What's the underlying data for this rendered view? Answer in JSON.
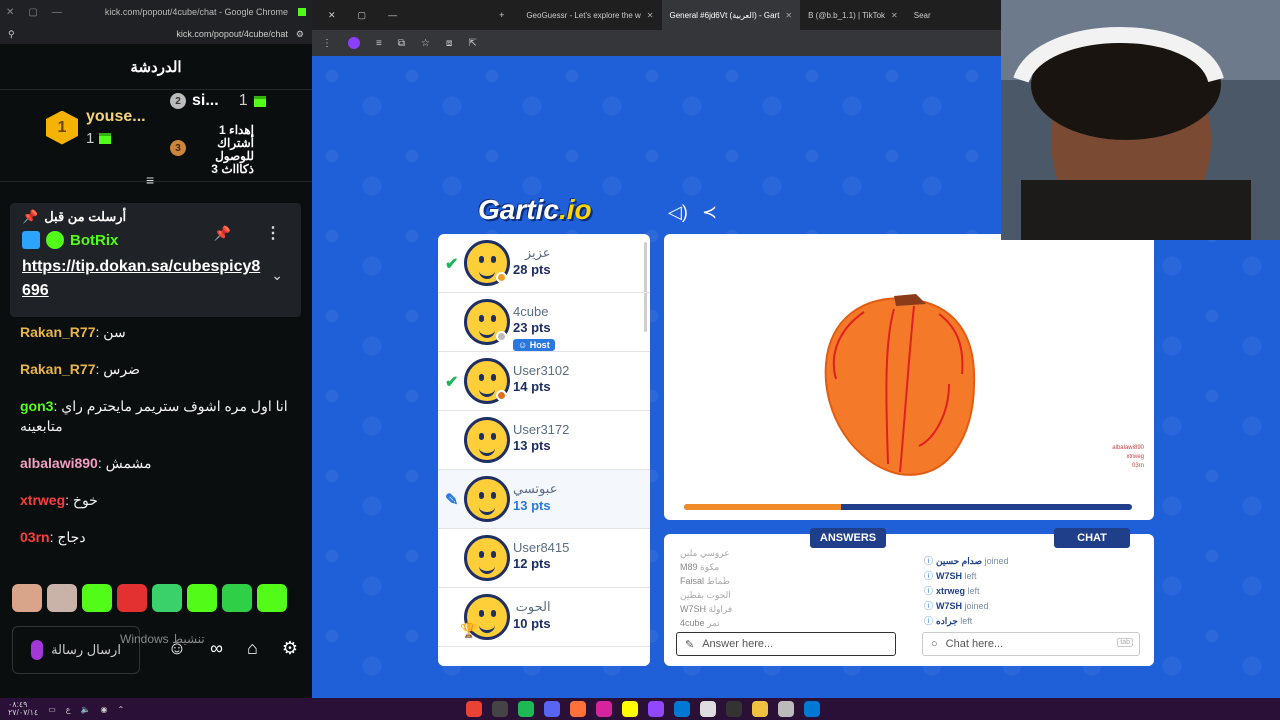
{
  "kick": {
    "window_title": "kick.com/popout/4cube/chat - Google Chrome",
    "url": "kick.com/popout/4cube/chat",
    "header": "الدردشة",
    "leaderboard": {
      "first": {
        "rank": "1",
        "name": "youse...",
        "count": "1"
      },
      "second": {
        "rank": "2",
        "name": "si...",
        "count": "1"
      },
      "third": {
        "rank": "3",
        "text": "إهداء 1\nأشتراك\nللوصول\n3 ذكاااث"
      }
    },
    "pinned": {
      "label": "أرسلت من قبل",
      "user": "BotRix",
      "link": "https://tip.dokan.sa/cubespicy8696"
    },
    "messages": [
      {
        "user": "Rakan_R77",
        "text": "سن",
        "color": "#e8b547"
      },
      {
        "user": "Rakan_R77",
        "text": "ضرس",
        "color": "#e8b547"
      },
      {
        "user": "gon3",
        "text": "انا اول مره اشوف ستريمر مايحترم راي متابعينه",
        "color": "#53fc18"
      },
      {
        "user": "albalawi890",
        "text": "مشمش",
        "color": "#f0a0c0"
      },
      {
        "user": "xtrweg",
        "text": "خوخ",
        "color": "#ff3b3b"
      },
      {
        "user": "03rn",
        "text": "دجاج",
        "color": "#ff3b3b"
      }
    ],
    "input_placeholder": "ارسال رسالة",
    "watermark": "Windows تنشيط"
  },
  "browser": {
    "tabs": [
      {
        "label": "GeoGuessr - Let's explore the w",
        "active": false
      },
      {
        "label": "General #6jd6Vt (العربية) - Gart",
        "active": true
      },
      {
        "label": "B (@b.b_1.1) | TikTok",
        "active": false
      },
      {
        "label": "Sear",
        "active": false
      }
    ]
  },
  "gartic": {
    "logo_main": "Gartic",
    "logo_suffix": ".io",
    "players": [
      {
        "name": "عزيز",
        "pts": "28 pts",
        "mark": "check",
        "status_color": "#f0a020",
        "rtl": true
      },
      {
        "name": "4cube",
        "pts": "23 pts",
        "host": "Host",
        "status_color": "#bbbbbb"
      },
      {
        "name": "User3102",
        "pts": "14 pts",
        "mark": "check",
        "status_color": "#e07020"
      },
      {
        "name": "User3172",
        "pts": "13 pts"
      },
      {
        "name": "عبوتسي",
        "pts": "13 pts",
        "mark": "pen",
        "rtl": true,
        "drawing": true
      },
      {
        "name": "User8415",
        "pts": "12 pts"
      },
      {
        "name": "الحوت",
        "pts": "10 pts",
        "trophy": true,
        "rtl": true
      }
    ],
    "timer_progress": 0.35,
    "canvas_overlay": [
      "albalawi890",
      "xtrweg",
      "03rn"
    ],
    "answers_tab": "ANSWERS",
    "chat_tab": "CHAT",
    "answers": [
      {
        "user": "",
        "text": "عروسي ملين"
      },
      {
        "user": "M89",
        "text": "مكوة"
      },
      {
        "user": "Faisal",
        "text": "طماط"
      },
      {
        "user": "",
        "text": "الحوت بقطين"
      },
      {
        "user": "W7SH",
        "text": "فراولة"
      },
      {
        "user": "4cube",
        "text": "تمر"
      }
    ],
    "chat": [
      {
        "user": "صدام حسين",
        "action": "joined"
      },
      {
        "user": "W7SH",
        "action": "left"
      },
      {
        "user": "xtrweg",
        "action": "left"
      },
      {
        "user": "W7SH",
        "action": "joined"
      },
      {
        "user": "جراده",
        "action": "left"
      }
    ],
    "answer_placeholder": "Answer here...",
    "chat_placeholder": "Chat here...",
    "chat_kbd": "tab"
  },
  "taskbar": {
    "time": "٠٨:٤٩",
    "date": "٢٧/٠٧/١٤"
  },
  "colors": {
    "gartic_bg": "#1f5fd8",
    "kick_green": "#53fc18",
    "timer_fill": "#f08c2a"
  }
}
